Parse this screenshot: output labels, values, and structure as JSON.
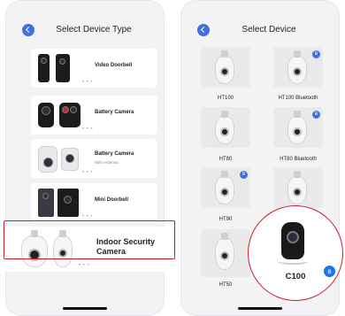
{
  "left_screen": {
    "title": "Select Device Type",
    "categories": [
      {
        "label": "Video Doorbell",
        "sub": ""
      },
      {
        "label": "Battery Camera",
        "sub": ""
      },
      {
        "label": "Battery Camera",
        "sub": "With Antenna"
      },
      {
        "label": "Mini Doorbell",
        "sub": ""
      }
    ],
    "highlight": {
      "label": "Indoor Security Camera"
    },
    "more_dots": "• • •"
  },
  "right_screen": {
    "title": "Select Device",
    "devices": [
      "HT100",
      "HT100 Bluetooth",
      "HT80",
      "HT80 Bluetooth",
      "HT90",
      "",
      "HT50"
    ],
    "highlight": {
      "label": "C100"
    },
    "bluetooth_glyph": "ʙ"
  },
  "colors": {
    "accent": "#3f6fe0",
    "highlight": "#c8202a"
  }
}
